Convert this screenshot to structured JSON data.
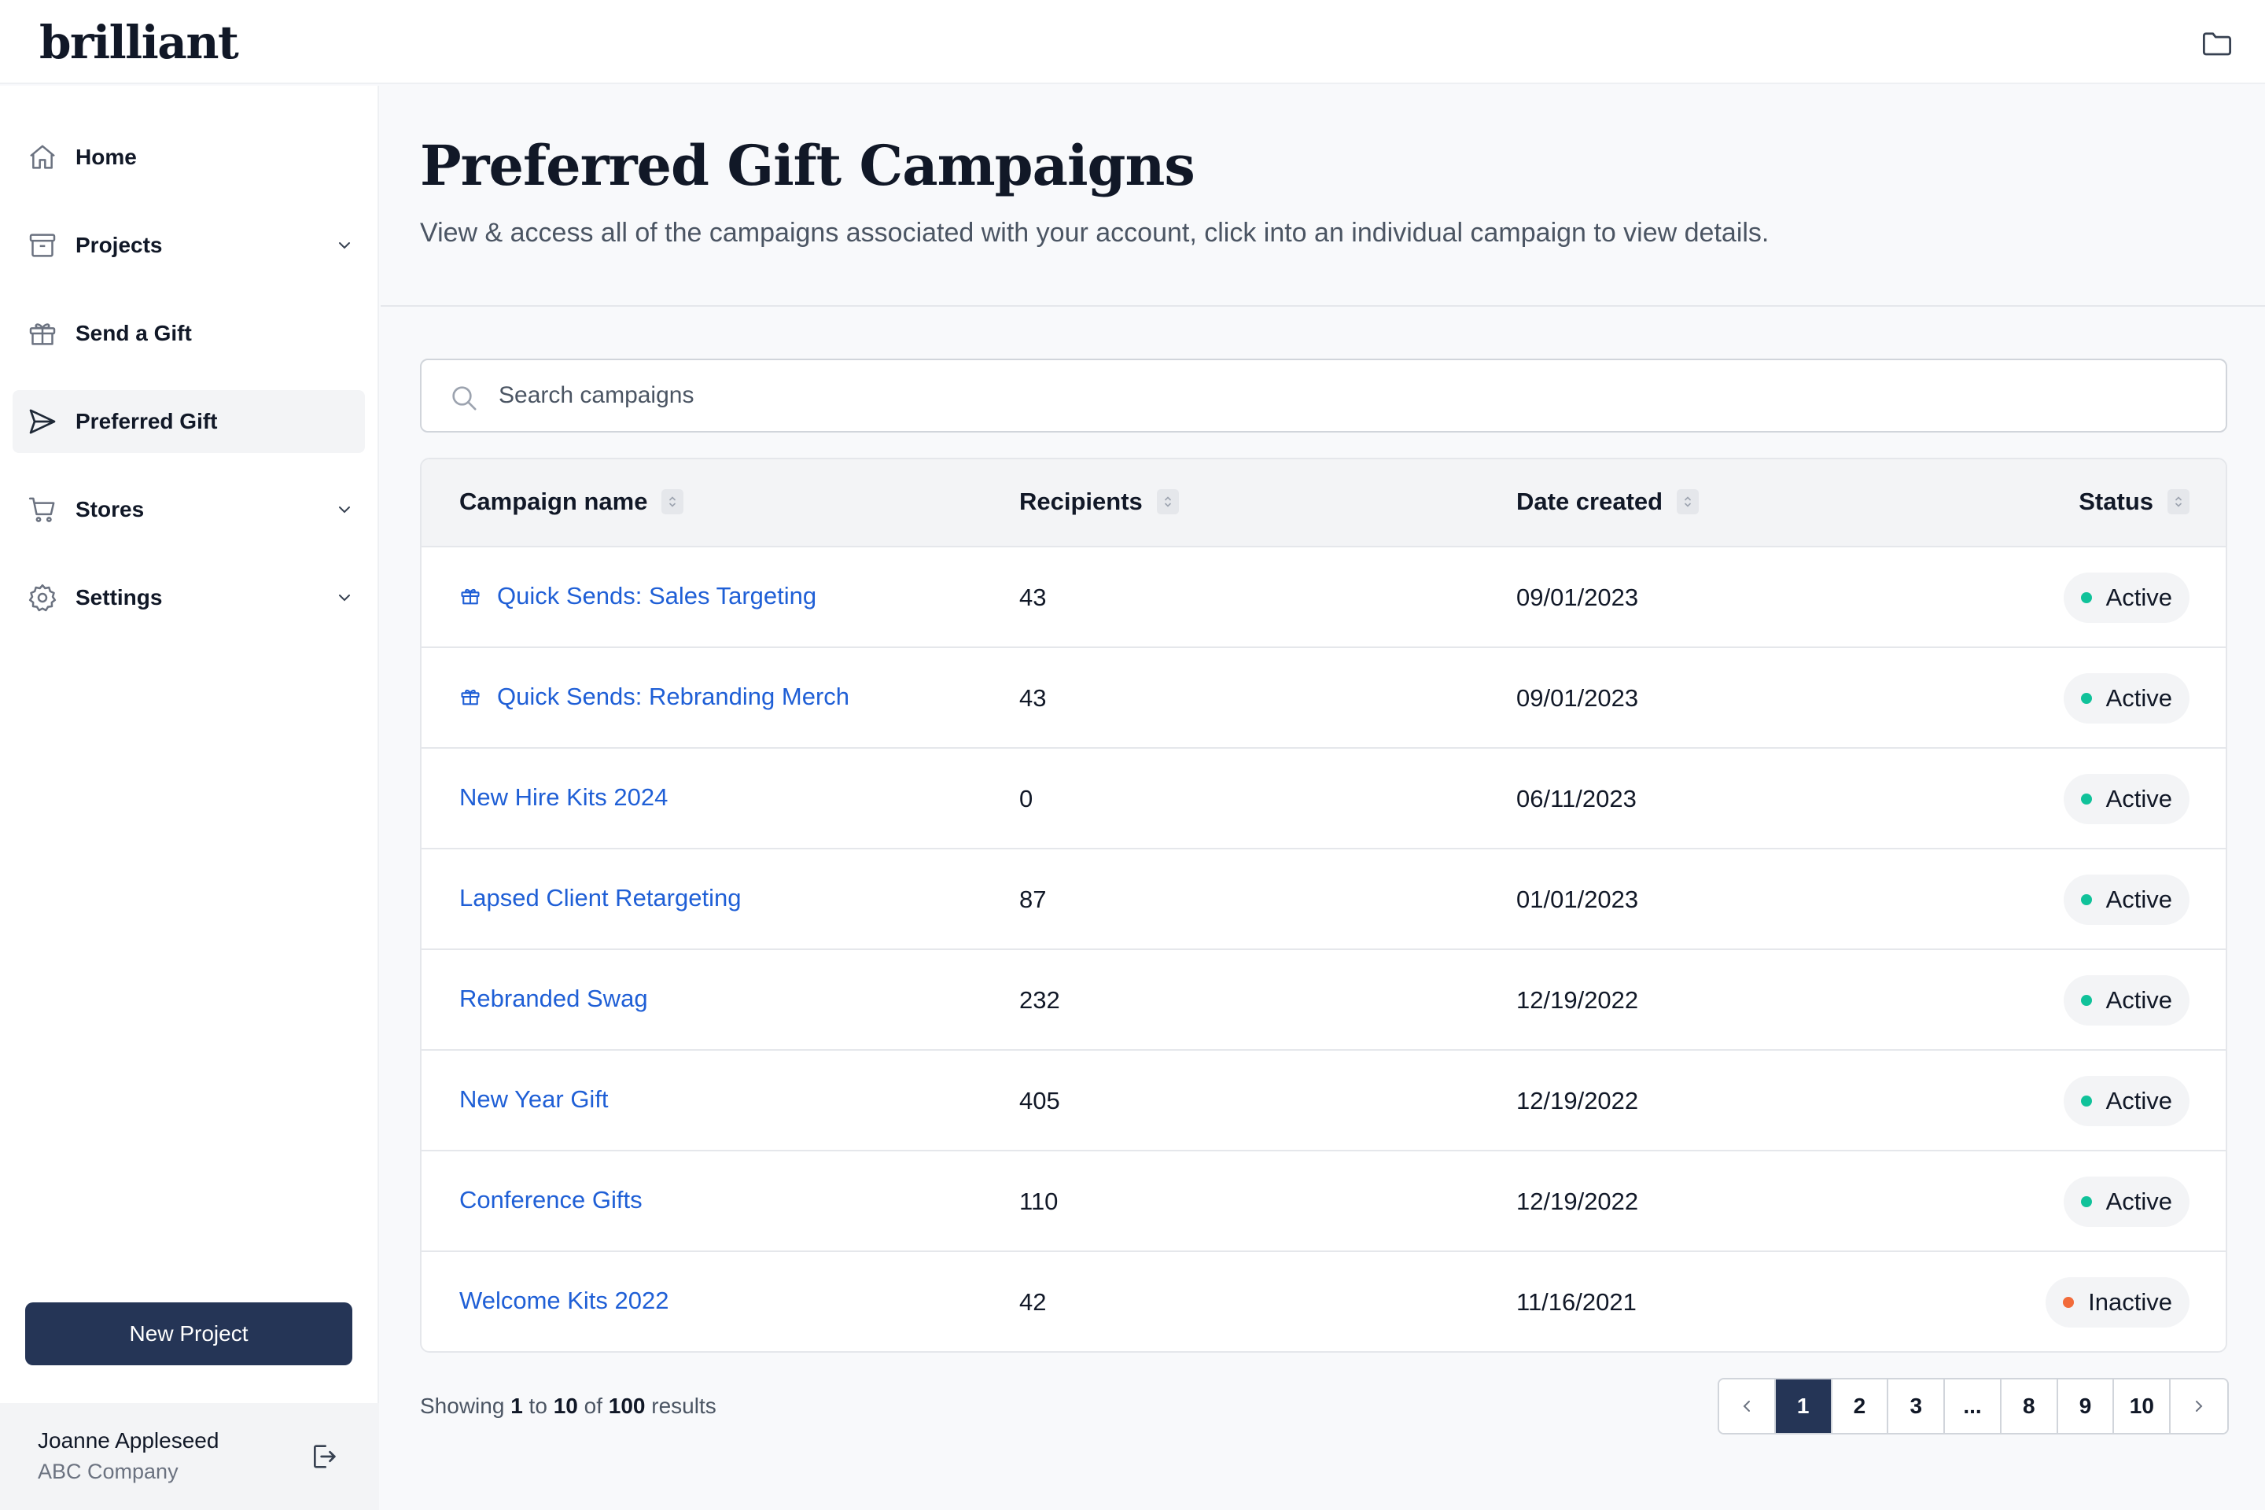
{
  "brand": {
    "logo_text": "brilliant"
  },
  "sidebar": {
    "items": [
      {
        "label": "Home",
        "icon": "home-icon"
      },
      {
        "label": "Projects",
        "icon": "archive-box-icon",
        "has_chevron": true
      },
      {
        "label": "Send a Gift",
        "icon": "gift-icon"
      },
      {
        "label": "Preferred Gift",
        "icon": "paper-plane-icon",
        "active": true
      },
      {
        "label": "Stores",
        "icon": "shopping-cart-icon",
        "has_chevron": true
      },
      {
        "label": "Settings",
        "icon": "gear-icon",
        "has_chevron": true
      }
    ],
    "new_project_label": "New Project",
    "user": {
      "name": "Joanne Appleseed",
      "company": "ABC Company"
    }
  },
  "header": {
    "title": "Preferred Gift Campaigns",
    "subtitle": "View & access all of the campaigns associated with your account, click into an individual campaign to view details."
  },
  "search": {
    "placeholder": "Search campaigns",
    "value": ""
  },
  "table": {
    "columns": [
      "Campaign name",
      "Recipients",
      "Date created",
      "Status"
    ],
    "rows": [
      {
        "name": "Quick Sends: Sales Targeting",
        "gift_icon": true,
        "recipients": "43",
        "date": "09/01/2023",
        "status": "Active"
      },
      {
        "name": "Quick Sends: Rebranding Merch",
        "gift_icon": true,
        "recipients": "43",
        "date": "09/01/2023",
        "status": "Active"
      },
      {
        "name": "New Hire Kits 2024",
        "gift_icon": false,
        "recipients": "0",
        "date": "06/11/2023",
        "status": "Active"
      },
      {
        "name": "Lapsed Client Retargeting",
        "gift_icon": false,
        "recipients": "87",
        "date": "01/01/2023",
        "status": "Active"
      },
      {
        "name": "Rebranded Swag",
        "gift_icon": false,
        "recipients": "232",
        "date": "12/19/2022",
        "status": "Active"
      },
      {
        "name": "New Year Gift",
        "gift_icon": false,
        "recipients": "405",
        "date": "12/19/2022",
        "status": "Active"
      },
      {
        "name": "Conference Gifts",
        "gift_icon": false,
        "recipients": "110",
        "date": "12/19/2022",
        "status": "Active"
      },
      {
        "name": "Welcome Kits 2022",
        "gift_icon": false,
        "recipients": "42",
        "date": "11/16/2021",
        "status": "Inactive"
      }
    ]
  },
  "pagination": {
    "showing_prefix": "Showing",
    "from": "1",
    "to_word": "to",
    "to": "10",
    "of_word": "of",
    "total": "100",
    "results_word": "results",
    "pages": [
      "1",
      "2",
      "3",
      "...",
      "8",
      "9",
      "10"
    ],
    "current": "1"
  },
  "colors": {
    "accent": "#253556",
    "link": "#1f5fd6",
    "active_dot": "#10c29a",
    "inactive_dot": "#f26b3a"
  }
}
